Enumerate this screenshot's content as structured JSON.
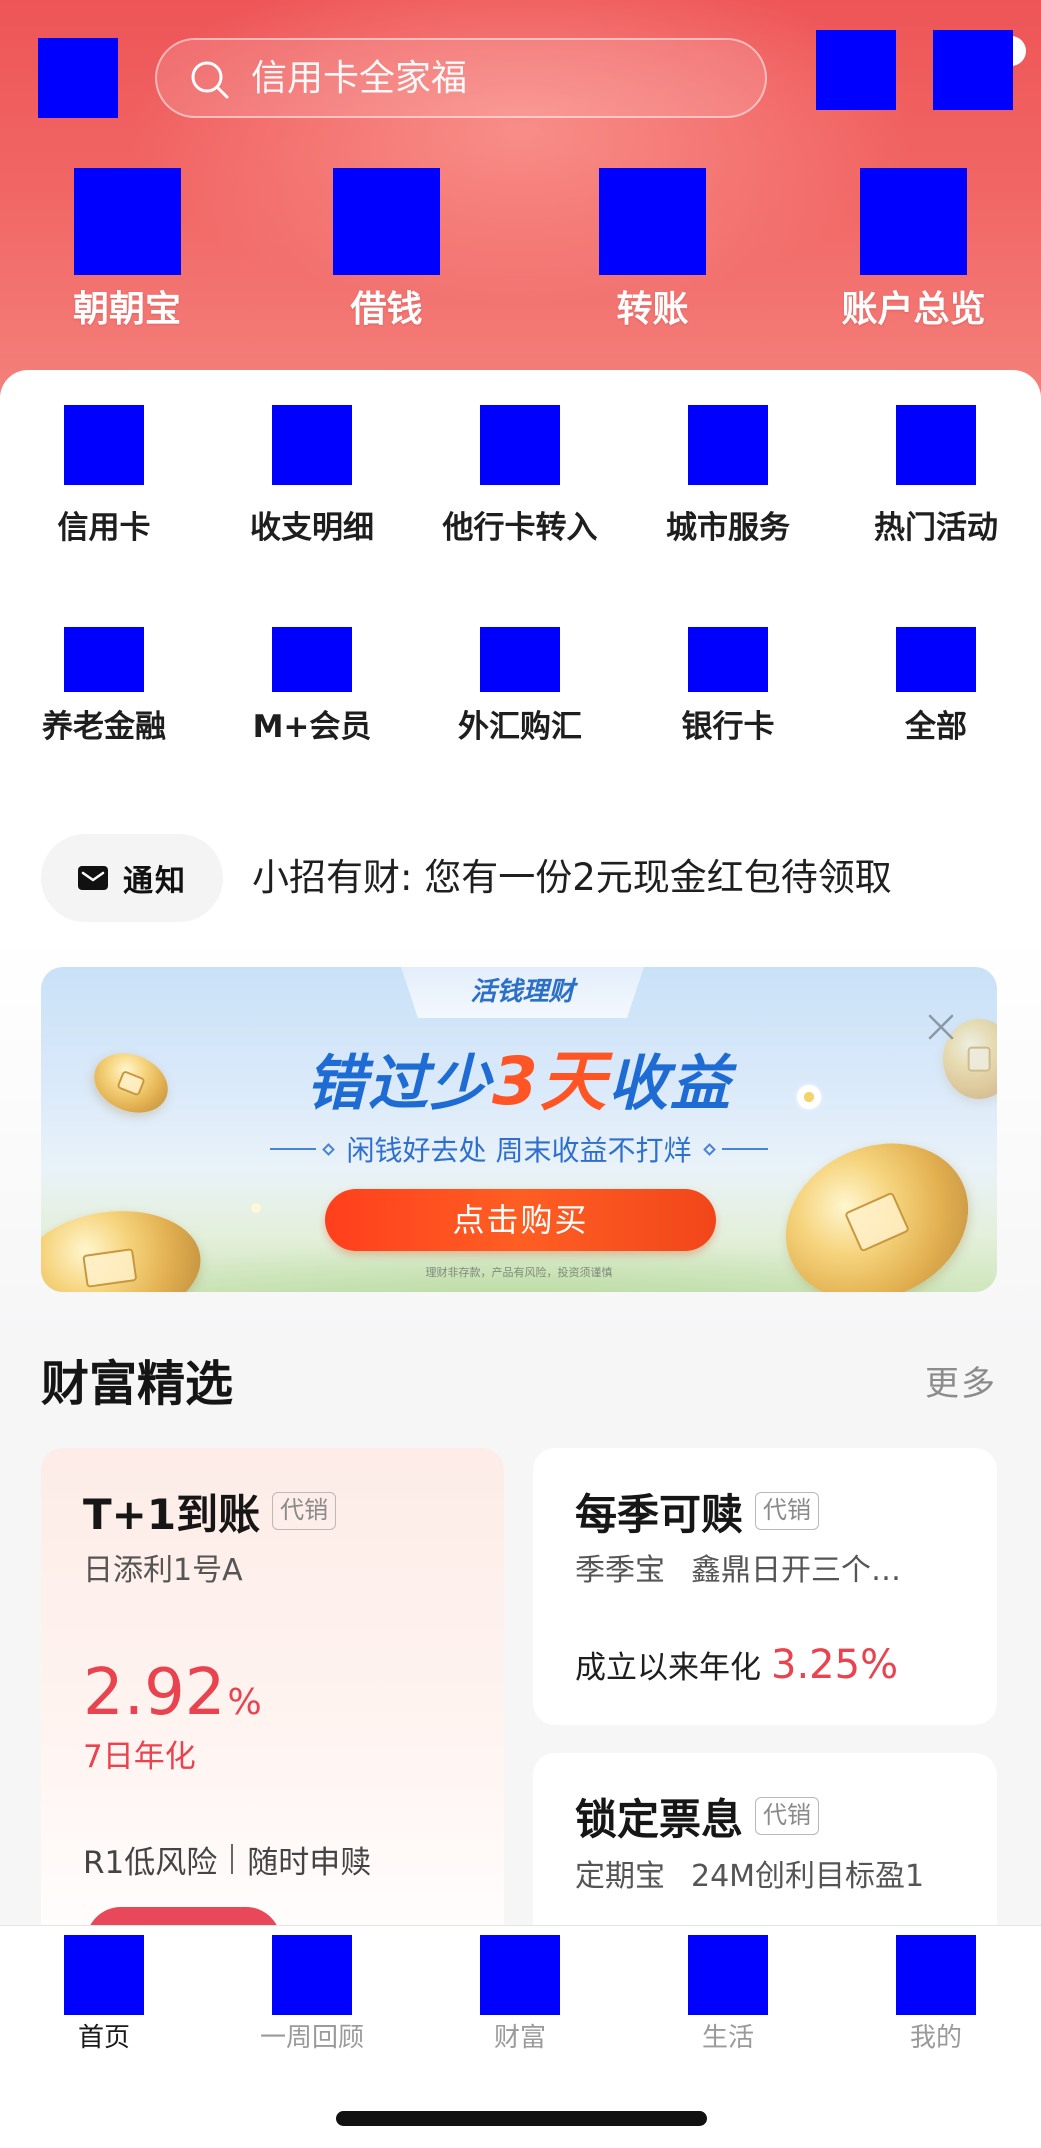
{
  "colors": {
    "accent": "#e8434f",
    "icon_placeholder": "#0000ff",
    "banner_blue": "#1e6bd3",
    "banner_orange": "#ff5424"
  },
  "header": {
    "left_icon": "scan-icon",
    "search": {
      "placeholder": "信用卡全家福",
      "icon": "search-icon"
    },
    "right_icons": [
      "customer-service-icon",
      "message-icon"
    ],
    "shortcuts": [
      {
        "label": "朝朝宝",
        "icon": "zhaozhaobao-icon"
      },
      {
        "label": "借钱",
        "icon": "borrow-icon"
      },
      {
        "label": "转账",
        "icon": "transfer-icon"
      },
      {
        "label": "账户总览",
        "icon": "account-overview-icon"
      }
    ]
  },
  "services": [
    {
      "label": "信用卡",
      "icon": "credit-card-icon"
    },
    {
      "label": "收支明细",
      "icon": "transactions-icon"
    },
    {
      "label": "他行卡转入",
      "icon": "inbound-transfer-icon"
    },
    {
      "label": "城市服务",
      "icon": "city-services-icon"
    },
    {
      "label": "热门活动",
      "icon": "hot-activities-icon"
    },
    {
      "label": "养老金融",
      "icon": "pension-icon"
    },
    {
      "label": "M+会员",
      "icon": "membership-icon"
    },
    {
      "label": "外汇购汇",
      "icon": "forex-icon"
    },
    {
      "label": "银行卡",
      "icon": "bank-card-icon"
    },
    {
      "label": "全部",
      "icon": "all-services-icon"
    }
  ],
  "notice": {
    "tag": "通知",
    "icon": "mail-icon",
    "text": "小招有财: 您有一份2元现金红包待领取"
  },
  "banner": {
    "tab": "活钱理财",
    "headline_pre": "错过少",
    "headline_highlight": "3天",
    "headline_post": "收益",
    "subline": "闲钱好去处 周末收益不打烊",
    "button": "点击购买",
    "disclaimer": "理财非存款，产品有风险，投资须谨慎"
  },
  "wealth": {
    "title": "财富精选",
    "more": "更多",
    "products": [
      {
        "title": "T+1到账",
        "badge": "代销",
        "names": [
          "日添利1号A"
        ],
        "rate": "2.92",
        "rate_unit": "%",
        "rate_label": "7日年化",
        "tags": [
          "R1低风险",
          "随时申赎"
        ]
      },
      {
        "title": "每季可赎",
        "badge": "代销",
        "names": [
          "季季宝",
          "鑫鼎日开三个…"
        ],
        "rate_label": "成立以来年化",
        "rate": "3.25%"
      },
      {
        "title": "锁定票息",
        "badge": "代销",
        "names": [
          "定期宝",
          "24M创利目标盈1"
        ]
      }
    ]
  },
  "tabbar": {
    "active_index": 0,
    "items": [
      {
        "label": "首页",
        "icon": "home-icon"
      },
      {
        "label": "一周回顾",
        "icon": "weekly-review-icon"
      },
      {
        "label": "财富",
        "icon": "wealth-icon"
      },
      {
        "label": "生活",
        "icon": "life-icon"
      },
      {
        "label": "我的",
        "icon": "profile-icon"
      }
    ]
  }
}
